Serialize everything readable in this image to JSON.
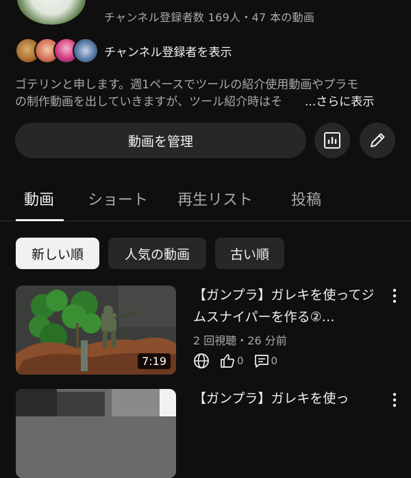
{
  "channel": {
    "name_cut": "",
    "stats": "チャンネル登録者数 169人・47 本の動画",
    "show_subscribers": "チャンネル登録者を表示",
    "description_line1": "ゴテリンと申します。週1ペースでツールの紹介使用動画やプラモ",
    "description_line2": "の制作動画を出していきますが、ツール紹介時はそ",
    "description_more": "...さらに表示",
    "manage_button": "動画を管理"
  },
  "tabs": [
    {
      "label": "動画",
      "active": true
    },
    {
      "label": "ショート",
      "active": false
    },
    {
      "label": "再生リスト",
      "active": false
    },
    {
      "label": "投稿",
      "active": false
    }
  ],
  "chips": [
    {
      "label": "新しい順",
      "selected": true
    },
    {
      "label": "人気の動画",
      "selected": false
    },
    {
      "label": "古い順",
      "selected": false
    }
  ],
  "videos": [
    {
      "title": "【ガンプラ】ガレキを使ってジムスナイパーを作る②…",
      "meta": "2 回視聴・26 分前",
      "duration": "7:19",
      "likes": "0",
      "comments": "0",
      "visibility_icon": "globe-icon"
    },
    {
      "title": "【ガンプラ】ガレキを使っ",
      "meta": "",
      "duration": ""
    }
  ],
  "colors": {
    "background": "#0f0f0f",
    "surface": "#272727",
    "text_primary": "#f1f1f1",
    "text_secondary": "#aaaaaa"
  }
}
